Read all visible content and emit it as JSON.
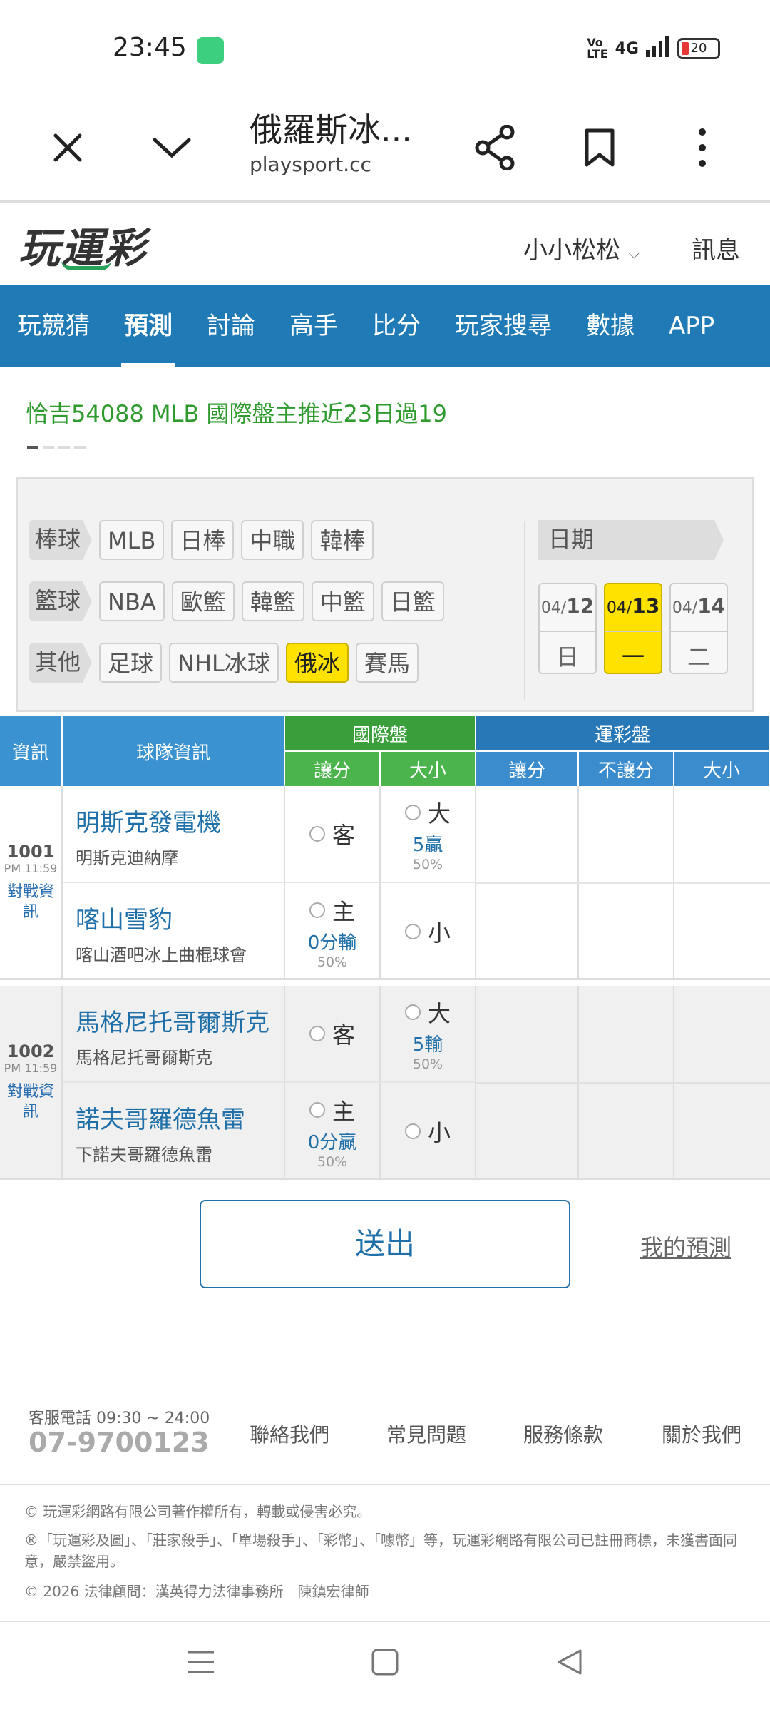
{
  "status": {
    "time": "23:45",
    "network": "4G",
    "battery": "20"
  },
  "browser": {
    "title": "俄羅斯冰...",
    "url": "playsport.cc"
  },
  "site": {
    "logo": "玩運彩",
    "user": "小小松松",
    "messages": "訊息"
  },
  "nav": [
    "玩競猜",
    "預測",
    "討論",
    "高手",
    "比分",
    "玩家搜尋",
    "數據",
    "APP"
  ],
  "ticker": "恰吉54088 MLB 國際盤主推近23日過19",
  "filter": {
    "rows": [
      {
        "cat": "棒球",
        "items": [
          "MLB",
          "日棒",
          "中職",
          "韓棒"
        ]
      },
      {
        "cat": "籃球",
        "items": [
          "NBA",
          "歐籃",
          "韓籃",
          "中籃",
          "日籃"
        ]
      },
      {
        "cat": "其他",
        "items": [
          "足球",
          "NHL冰球",
          "俄冰",
          "賽馬"
        ]
      }
    ],
    "date_label": "日期",
    "dates": [
      {
        "md": "04/",
        "d": "12",
        "w": "日"
      },
      {
        "md": "04/",
        "d": "13",
        "w": "一"
      },
      {
        "md": "04/",
        "d": "14",
        "w": "二"
      }
    ]
  },
  "table": {
    "h_info": "資訊",
    "h_team": "球隊資訊",
    "h_intl": "國際盤",
    "h_sport": "運彩盤",
    "h_spread": "讓分",
    "h_total": "大小",
    "h_s_spread": "讓分",
    "h_s_nospread": "不讓分",
    "h_s_total": "大小"
  },
  "games": [
    {
      "num": "1001",
      "time": "PM 11:59",
      "vs": "對戰資訊",
      "away": {
        "name": "明斯克發電機",
        "sub": "明斯克迪納摩"
      },
      "home": {
        "name": "喀山雪豹",
        "sub": "喀山酒吧冰上曲棍球會"
      },
      "spread_away": {
        "label": "客"
      },
      "spread_home": {
        "label": "主",
        "line": "0分輸",
        "pct": "50%"
      },
      "total_over": {
        "label": "大",
        "line": "5贏",
        "pct": "50%"
      },
      "total_under": {
        "label": "小"
      }
    },
    {
      "num": "1002",
      "time": "PM 11:59",
      "vs": "對戰資訊",
      "away": {
        "name": "馬格尼托哥爾斯克",
        "sub": "馬格尼托哥爾斯克"
      },
      "home": {
        "name": "諾夫哥羅德魚雷",
        "sub": "下諾夫哥羅德魚雷"
      },
      "spread_away": {
        "label": "客"
      },
      "spread_home": {
        "label": "主",
        "line": "0分贏",
        "pct": "50%"
      },
      "total_over": {
        "label": "大",
        "line": "5輸",
        "pct": "50%"
      },
      "total_under": {
        "label": "小"
      }
    }
  ],
  "submit": "送出",
  "my_predictions": "我的預測",
  "footer": {
    "hours": "客服電話 09:30 ~ 24:00",
    "phone": "07-9700123",
    "links": [
      "聯絡我們",
      "常見問題",
      "服務條款",
      "關於我們"
    ],
    "copy1": "© 玩運彩網路有限公司著作權所有，轉載或侵害必究。",
    "copy2": "®「玩運彩及圖」、「莊家殺手」、「單場殺手」、「彩幣」、「噱幣」等，玩運彩網路有限公司已註冊商標，未獲書面同意，嚴禁盜用。",
    "copy3": "© 2026 法律顧問：漢英得力法律事務所　陳鎮宏律師"
  }
}
